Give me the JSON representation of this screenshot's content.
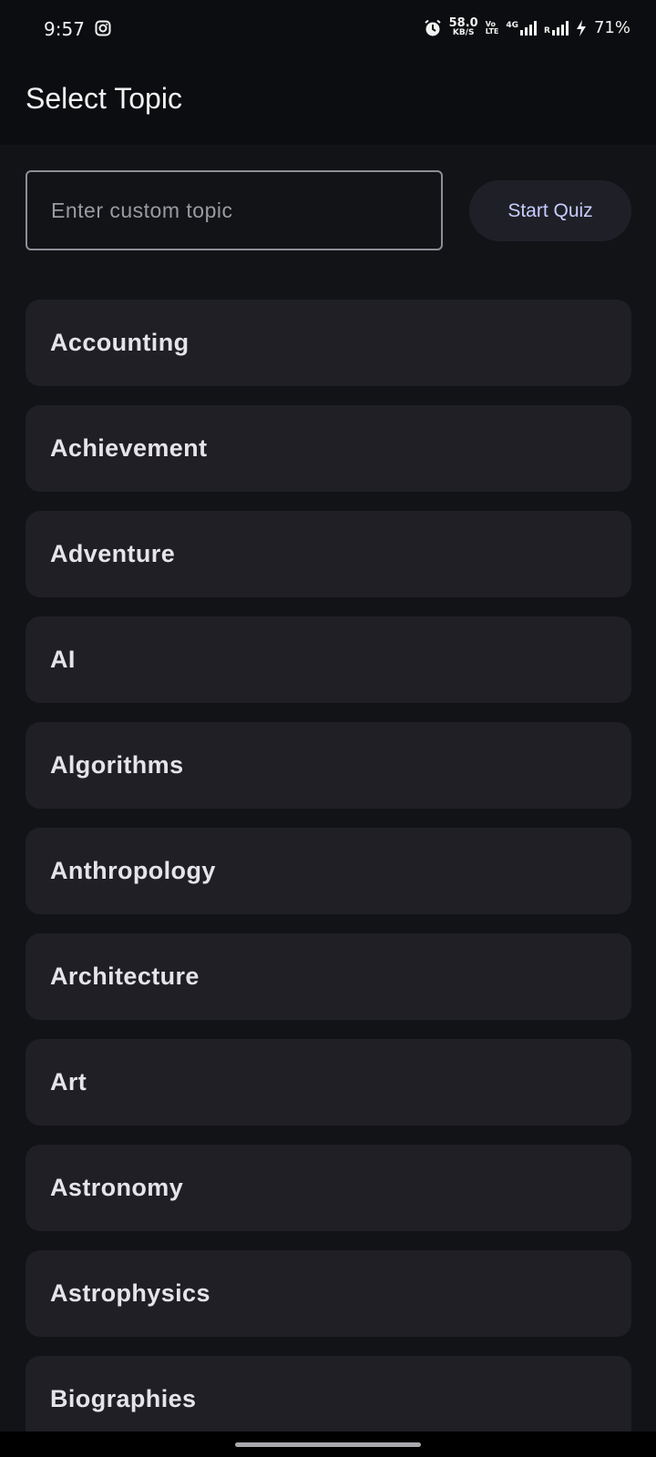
{
  "status_bar": {
    "time": "9:57",
    "net_speed_value": "58.0",
    "net_speed_unit": "KB/S",
    "volte_top": "Vo",
    "volte_bottom": "LTE",
    "network_type": "4G",
    "roaming": "R",
    "battery_percent": "71%"
  },
  "app_bar": {
    "title": "Select Topic"
  },
  "custom_topic": {
    "placeholder": "Enter custom topic",
    "value": ""
  },
  "start_button": {
    "label": "Start Quiz"
  },
  "topics": [
    "Accounting",
    "Achievement",
    "Adventure",
    "AI",
    "Algorithms",
    "Anthropology",
    "Architecture",
    "Art",
    "Astronomy",
    "Astrophysics",
    "Biographies"
  ],
  "colors": {
    "background": "#0c0d10",
    "content_bg": "#121317",
    "card_bg": "#1f1f25",
    "accent_text": "#c7ccff"
  }
}
